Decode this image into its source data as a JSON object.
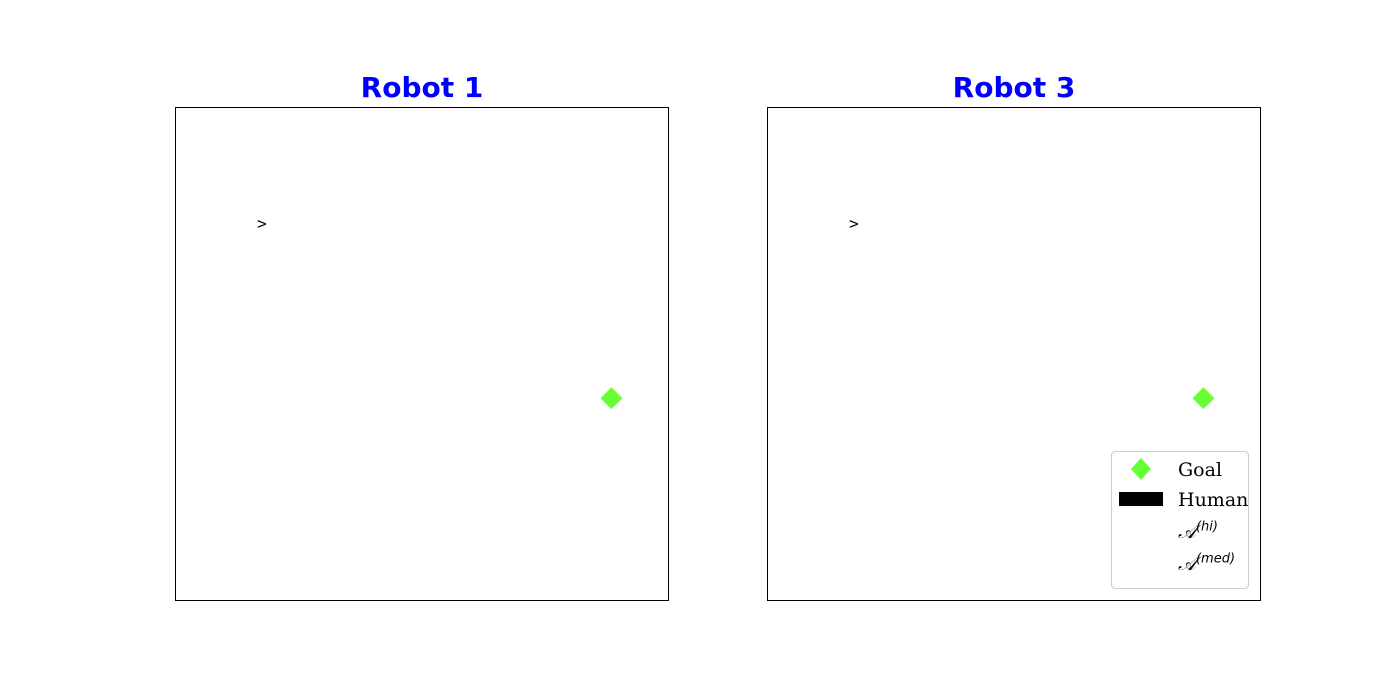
{
  "chart_data": [
    {
      "type": "scatter",
      "title": "Robot 1",
      "title_color": "#0000ff",
      "xlim": [
        0,
        10
      ],
      "ylim": [
        0,
        10
      ],
      "axes_ticks_visible": false,
      "grid": false,
      "robot": {
        "x": 1.75,
        "y": 7.65,
        "glyph": ">",
        "color": "#000000"
      },
      "goal": {
        "x": 8.85,
        "y": 4.1,
        "marker": "diamond",
        "color": "#66ff33"
      }
    },
    {
      "type": "scatter",
      "title": "Robot 3",
      "title_color": "#0000ff",
      "xlim": [
        0,
        10
      ],
      "ylim": [
        0,
        10
      ],
      "axes_ticks_visible": false,
      "grid": false,
      "robot": {
        "x": 1.75,
        "y": 7.65,
        "glyph": ">",
        "color": "#000000"
      },
      "goal": {
        "x": 8.85,
        "y": 4.1,
        "marker": "diamond",
        "color": "#66ff33"
      },
      "legend": {
        "placement": "lower-right",
        "entries": [
          {
            "label": "Goal",
            "handle": "diamond",
            "color": "#66ff33"
          },
          {
            "label": "Human",
            "handle": "rect",
            "color": "#000000"
          },
          {
            "label_base": "𝒜",
            "label_sup": "(hi)",
            "handle": "none"
          },
          {
            "label_base": "𝒜",
            "label_sup": "(med)",
            "handle": "none"
          }
        ]
      }
    }
  ]
}
